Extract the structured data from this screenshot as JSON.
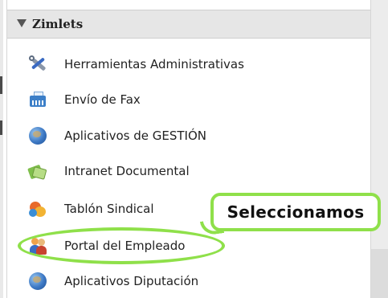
{
  "panel": {
    "title": "Zimlets",
    "items": [
      {
        "label": "Herramientas Administrativas",
        "icon": "tools-icon"
      },
      {
        "label": "Envío de Fax",
        "icon": "fax-icon"
      },
      {
        "label": "Aplicativos de GESTIÓN",
        "icon": "globe-icon"
      },
      {
        "label": "Intranet Documental",
        "icon": "intranet-icon"
      },
      {
        "label": "Tablón Sindical",
        "icon": "tablon-icon"
      },
      {
        "label": "Portal del Empleado",
        "icon": "portal-icon"
      },
      {
        "label": "Aplicativos Diputación",
        "icon": "globe-icon"
      }
    ]
  },
  "callout": {
    "text": "Seleccionamos",
    "color": "#8fe04a"
  }
}
